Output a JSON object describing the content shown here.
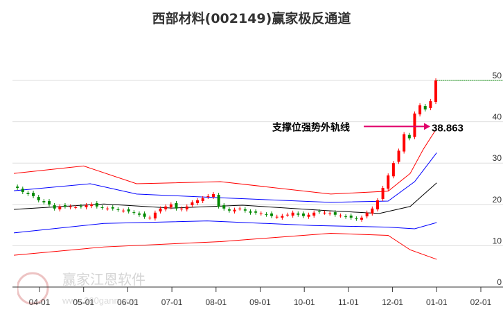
{
  "chart_data": {
    "type": "candlestick",
    "title": "西部材料(002149)赢家极反通道",
    "y_ticks": [
      0,
      10,
      20,
      30,
      40,
      50
    ],
    "ylim": [
      0,
      50
    ],
    "x_ticks": [
      "04-01",
      "05-01",
      "06-01",
      "07-01",
      "08-01",
      "09-01",
      "10-01",
      "11-01",
      "12-01",
      "01-01",
      "02-01"
    ],
    "x_unit": "months since 04-01",
    "close_start_t": -0.5,
    "close_step_t": 0.12,
    "closes": [
      24,
      23,
      22.5,
      22,
      21,
      20.5,
      20,
      19,
      19.5,
      19.5,
      19.5,
      19.3,
      19.5,
      19.8,
      20,
      19.5,
      19.2,
      19,
      19,
      18.7,
      18.5,
      18.3,
      18,
      17.5,
      17,
      16.8,
      18,
      19,
      19.5,
      20,
      19,
      19,
      19.5,
      20.5,
      21,
      21.5,
      22,
      22.5,
      19.5,
      19,
      18.5,
      18.7,
      19,
      18.5,
      18,
      18,
      17.8,
      17.5,
      17.2,
      17,
      17.2,
      17.5,
      18,
      17.5,
      17.2,
      17.5,
      18,
      18.2,
      18,
      17.8,
      17.5,
      17.3,
      17,
      16.8,
      16.5,
      16.8,
      18,
      19,
      21,
      24,
      27,
      30,
      33,
      37,
      36,
      42,
      44,
      43,
      45,
      50
    ],
    "bands": [
      {
        "name": "upper-outer",
        "color": "#ff0000",
        "points": [
          [
            -0.58,
            27.5
          ],
          [
            1,
            29.3
          ],
          [
            2.2,
            25
          ],
          [
            4.1,
            25.5
          ],
          [
            6.6,
            22.5
          ],
          [
            7.9,
            23.2
          ],
          [
            8.4,
            27.5
          ],
          [
            8.7,
            33.4
          ],
          [
            9,
            38.4
          ]
        ]
      },
      {
        "name": "upper-inner",
        "color": "#0000ff",
        "points": [
          [
            -0.58,
            23.3
          ],
          [
            1.15,
            25
          ],
          [
            2.2,
            22.5
          ],
          [
            4.1,
            21.6
          ],
          [
            6.6,
            20.5
          ],
          [
            7.9,
            20.8
          ],
          [
            8.5,
            25.5
          ],
          [
            9,
            32.5
          ]
        ]
      },
      {
        "name": "middle",
        "color": "#000000",
        "points": [
          [
            -0.58,
            18.8
          ],
          [
            1.46,
            20.1
          ],
          [
            3,
            19.1
          ],
          [
            4.6,
            19.8
          ],
          [
            6.5,
            18.5
          ],
          [
            7.7,
            17.8
          ],
          [
            8.4,
            19.5
          ],
          [
            9,
            25.2
          ]
        ]
      },
      {
        "name": "lower-inner",
        "color": "#0000ff",
        "points": [
          [
            -0.58,
            13.1
          ],
          [
            1.46,
            15.4
          ],
          [
            3.8,
            16
          ],
          [
            6.2,
            14.9
          ],
          [
            7.9,
            14.5
          ],
          [
            8.5,
            14.1
          ],
          [
            9,
            15.6
          ]
        ]
      },
      {
        "name": "lower-outer",
        "color": "#ff0000",
        "points": [
          [
            -0.58,
            7.7
          ],
          [
            1.46,
            9.7
          ],
          [
            4.1,
            11
          ],
          [
            6.6,
            13
          ],
          [
            7.9,
            12.5
          ],
          [
            8.4,
            9
          ],
          [
            9,
            6.7
          ]
        ]
      }
    ],
    "high_line": 50,
    "annotation": {
      "label": "支撑位强势外轨线",
      "value": "38.863",
      "y": 38.863
    }
  },
  "watermark": {
    "name": "赢家江恩软件",
    "url": "www.360gann.com",
    "seal": "江赢恩家"
  }
}
